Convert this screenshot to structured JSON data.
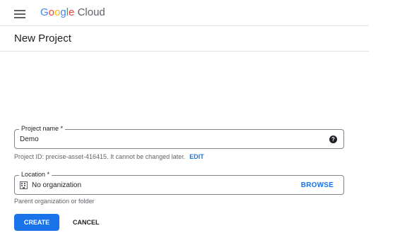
{
  "app": {
    "logo_google": "Google",
    "logo_cloud": "Cloud"
  },
  "page": {
    "title": "New Project"
  },
  "project_name": {
    "label": "Project name *",
    "value": "Demo",
    "help_icon": "help-icon",
    "project_id_hint": "Project ID: precise-asset-416415. It cannot be changed later.",
    "edit_link": "EDIT"
  },
  "location": {
    "label": "Location *",
    "value": "No organization",
    "icon": "organization-icon",
    "browse_button": "BROWSE",
    "hint": "Parent organization or folder"
  },
  "actions": {
    "create": "CREATE",
    "cancel": "CANCEL"
  },
  "colors": {
    "primary": "#1a73e8",
    "google_blue": "#4285f4",
    "google_red": "#ea4335",
    "google_yellow": "#fbbc05",
    "google_green": "#34a853"
  }
}
